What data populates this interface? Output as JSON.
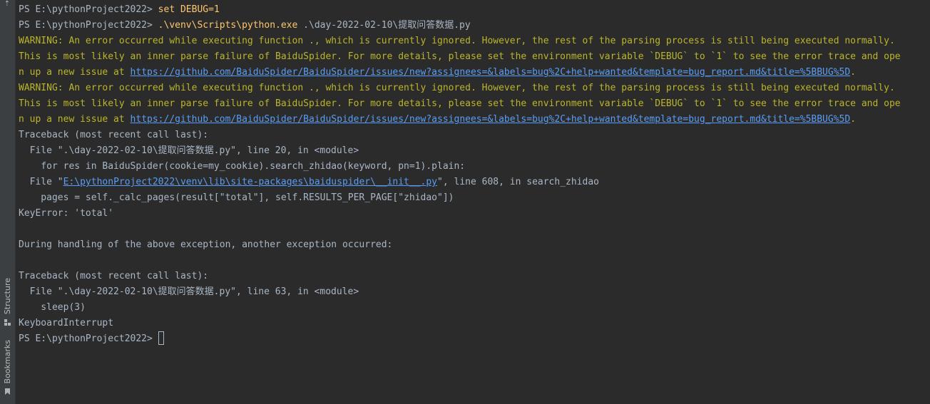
{
  "sidebar": {
    "structure_label": "Structure",
    "bookmarks_label": "Bookmarks",
    "top_icon": "collapse-icon"
  },
  "terminal": {
    "prompt": "PS E:\\pythonProject2022> ",
    "cmd1": "set DEBUG=1",
    "cmd2": ".\\venv\\Scripts\\python.exe",
    "cmd2_args": " .\\day-2022-02-10\\提取问答数据.py",
    "warning_line1": "WARNING: An error occurred while executing function ., which is currently ignored. However, the rest of the parsing process is still being executed normally.",
    "warning_line2": "This is most likely an inner parse failure of BaiduSpider. For more details, please set the environment variable `DEBUG` to `1` to see the error trace and ope",
    "warning_line3_prefix": "n up a new issue at ",
    "warning_link": "https://github.com/BaiduSpider/BaiduSpider/issues/new?assignees=&labels=bug%2C+help+wanted&template=bug_report.md&title=%5BBUG%5D",
    "warning_line3_suffix": ".",
    "traceback_header": "Traceback (most recent call last):",
    "file1": "  File \".\\day-2022-02-10\\提取问答数据.py\", line 20, in <module>",
    "code1": "    for res in BaiduSpider(cookie=my_cookie).search_zhidao(keyword, pn=1).plain:",
    "file2_prefix": "  File \"",
    "file2_link": "E:\\pythonProject2022\\venv\\lib\\site-packages\\baiduspider\\__init__.py",
    "file2_suffix": "\", line 608, in search_zhidao",
    "code2": "    pages = self._calc_pages(result[\"total\"], self.RESULTS_PER_PAGE[\"zhidao\"])",
    "key_error": "KeyError: 'total'",
    "during_handling": "During handling of the above exception, another exception occurred:",
    "file3": "  File \".\\day-2022-02-10\\提取问答数据.py\", line 63, in <module>",
    "code3": "    sleep(3)",
    "keyboard_interrupt": "KeyboardInterrupt"
  },
  "colors": {
    "background": "#2b2b2b",
    "text": "#a9b7c6",
    "command": "#ffc66d",
    "warning": "#bbb529",
    "link": "#589df6"
  }
}
